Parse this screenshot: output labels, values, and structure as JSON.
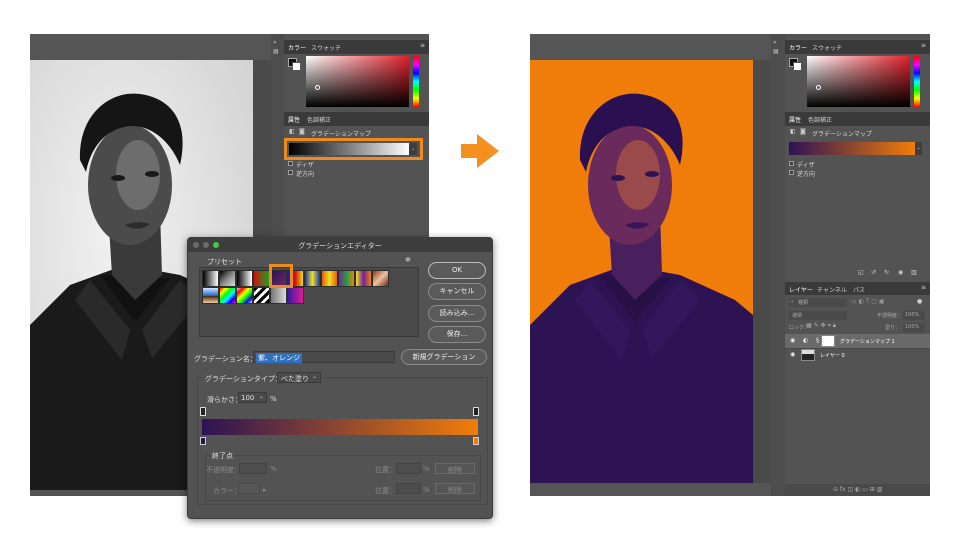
{
  "left_panel": {
    "tabs": {
      "color": "カラー",
      "swatches": "スウォッチ"
    },
    "properties": {
      "tab_properties": "属性",
      "tab_adjustments": "色調補正",
      "layer_type": "グラデーションマップ",
      "dither": "ディザ",
      "reverse": "逆方向"
    }
  },
  "dialog": {
    "title": "グラデーションエディター",
    "presets_label": "プリセット",
    "buttons": {
      "ok": "OK",
      "cancel": "キャンセル",
      "load": "読み込み...",
      "save": "保存...",
      "new_gradient": "新規グラデーション"
    },
    "name_label": "グラデーション名：",
    "name_value": "紫、オレンジ",
    "type_label": "グラデーションタイプ：",
    "type_value": "べた塗り",
    "smoothness_label": "滑らかさ：",
    "smoothness_value": "100",
    "percent": "%",
    "stops_label": "終了点",
    "opacity_label": "不透明度：",
    "color_label": "カラー：",
    "location_label": "位置：",
    "delete_label": "削除",
    "gradient_colors": {
      "start": "#2d1254",
      "end": "#f07d0a"
    }
  },
  "right_panel": {
    "tabs": {
      "color": "カラー",
      "swatches": "スウォッチ"
    },
    "properties": {
      "tab_properties": "属性",
      "tab_adjustments": "色調補正",
      "layer_type": "グラデーションマップ",
      "dither": "ディザ",
      "reverse": "逆方向"
    },
    "layers": {
      "tab_layers": "レイヤー",
      "tab_channels": "チャンネル",
      "tab_paths": "パス",
      "filter_kind": "種類",
      "blend_mode": "通常",
      "opacity_label": "不透明度：",
      "opacity_value": "100%",
      "lock_label": "ロック：",
      "fill_label": "塗り：",
      "fill_value": "100%",
      "items": [
        {
          "name": "グラデーションマップ 1"
        },
        {
          "name": "レイヤー 0"
        }
      ]
    }
  },
  "colors": {
    "arrow": "#f4901e",
    "highlight": "#f08a1c",
    "orange_bg": "#f07d0a",
    "purple": "#2d1254"
  }
}
